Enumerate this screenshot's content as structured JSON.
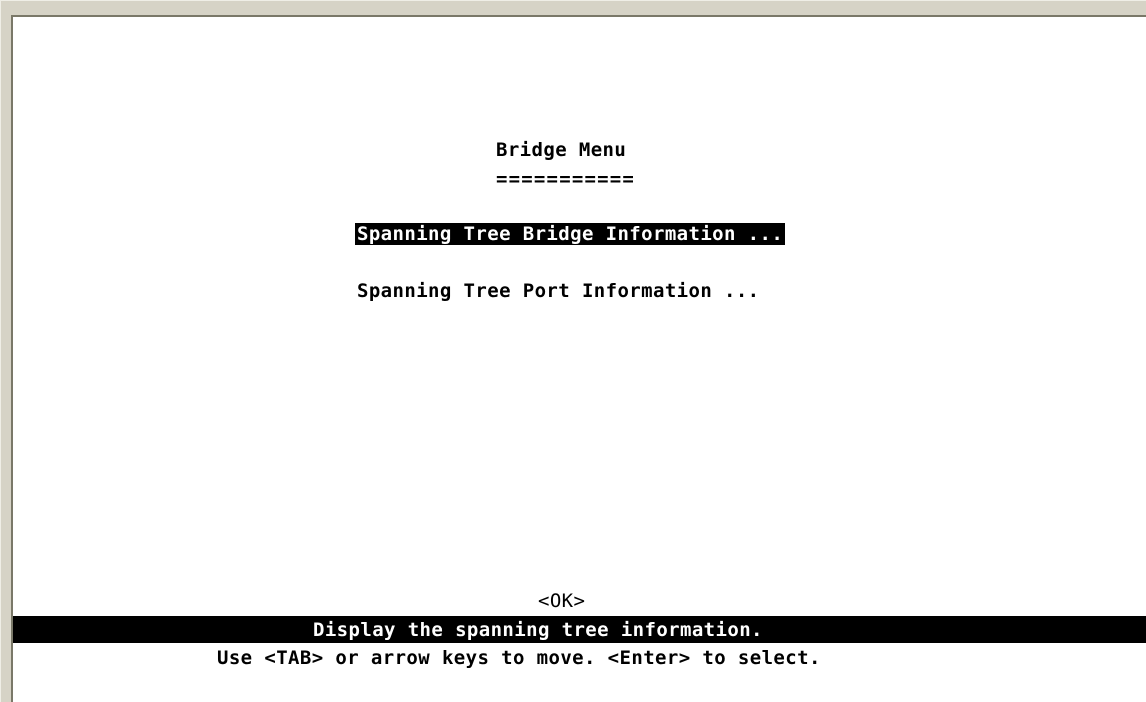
{
  "menu": {
    "title": "Bridge Menu",
    "title_underline": "===========",
    "items": [
      {
        "label": "Spanning Tree Bridge Information ...",
        "selected": true
      },
      {
        "label": "Spanning Tree Port Information ...",
        "selected": false
      }
    ]
  },
  "ok_button": {
    "label": "<OK>"
  },
  "status_bar": {
    "text": "Display the spanning tree information."
  },
  "help": {
    "text": "Use <TAB> or arrow keys to move. <Enter> to select."
  },
  "colors": {
    "background": "#ffffff",
    "text": "#000000",
    "highlight_bg": "#000000",
    "highlight_fg": "#ffffff",
    "window_chrome": "#d6d3c6"
  }
}
